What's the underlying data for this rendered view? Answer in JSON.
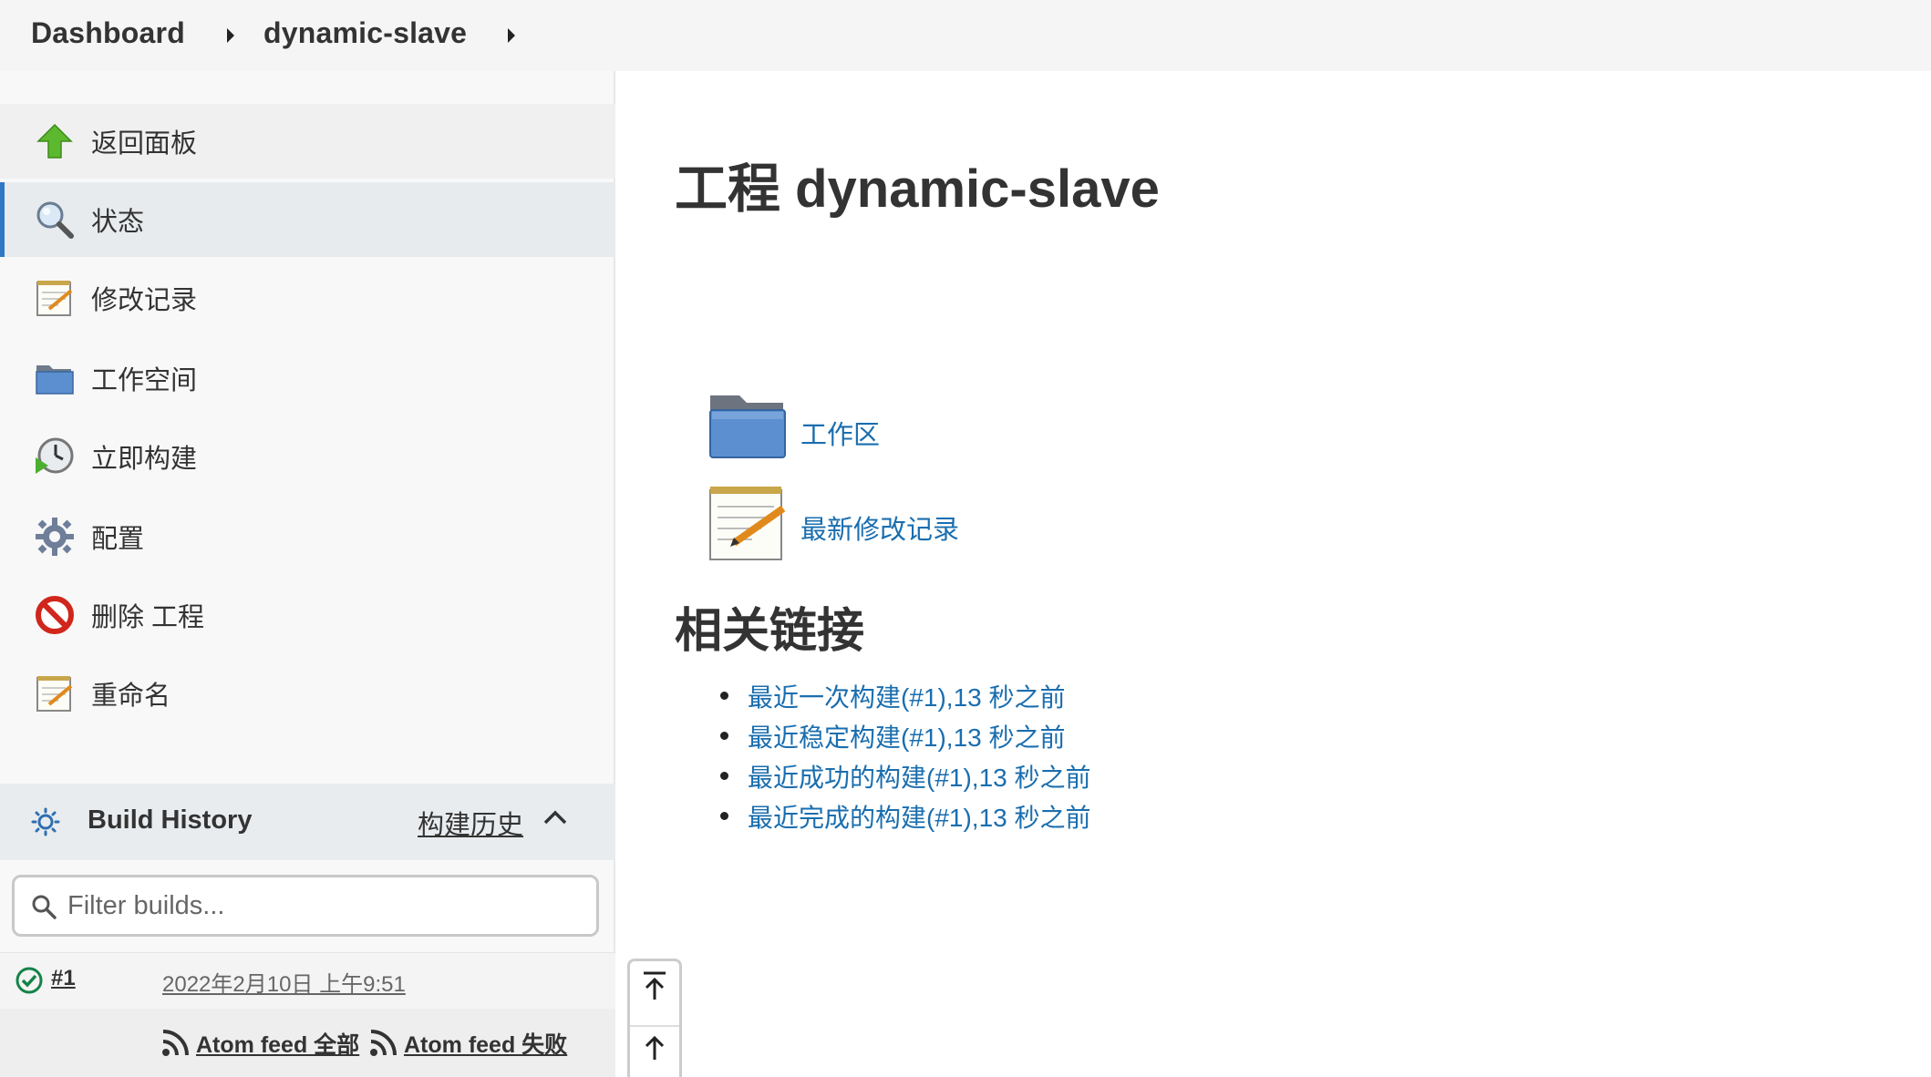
{
  "breadcrumb": {
    "items": [
      "Dashboard",
      "dynamic-slave"
    ]
  },
  "sidebar": {
    "items": [
      {
        "label": "返回面板",
        "icon": "up-arrow-icon"
      },
      {
        "label": "状态",
        "icon": "magnifier-icon"
      },
      {
        "label": "修改记录",
        "icon": "notepad-icon"
      },
      {
        "label": "工作空间",
        "icon": "folder-icon"
      },
      {
        "label": "立即构建",
        "icon": "build-clock-icon"
      },
      {
        "label": "配置",
        "icon": "gear-icon"
      },
      {
        "label": "删除 工程",
        "icon": "no-entry-icon"
      },
      {
        "label": "重命名",
        "icon": "notepad-icon"
      }
    ],
    "active_index": 1
  },
  "build_history": {
    "title": "Build History",
    "link": "构建历史",
    "filter_placeholder": "Filter builds...",
    "builds": [
      {
        "number": "#1",
        "date": "2022年2月10日 上午9:51",
        "status": "success"
      }
    ],
    "feeds": [
      "Atom feed 全部",
      "Atom feed 失败"
    ]
  },
  "main": {
    "title": "工程 dynamic-slave",
    "links": [
      "工作区",
      "最新修改记录"
    ],
    "related_title": "相关链接",
    "related_links": [
      "最近一次构建(#1),13 秒之前",
      "最近稳定构建(#1),13 秒之前",
      "最近成功的构建(#1),13 秒之前",
      "最近完成的构建(#1),13 秒之前"
    ]
  },
  "colors": {
    "link": "#1a6eaf",
    "active_accent": "#2f78c4",
    "success": "#138347"
  }
}
